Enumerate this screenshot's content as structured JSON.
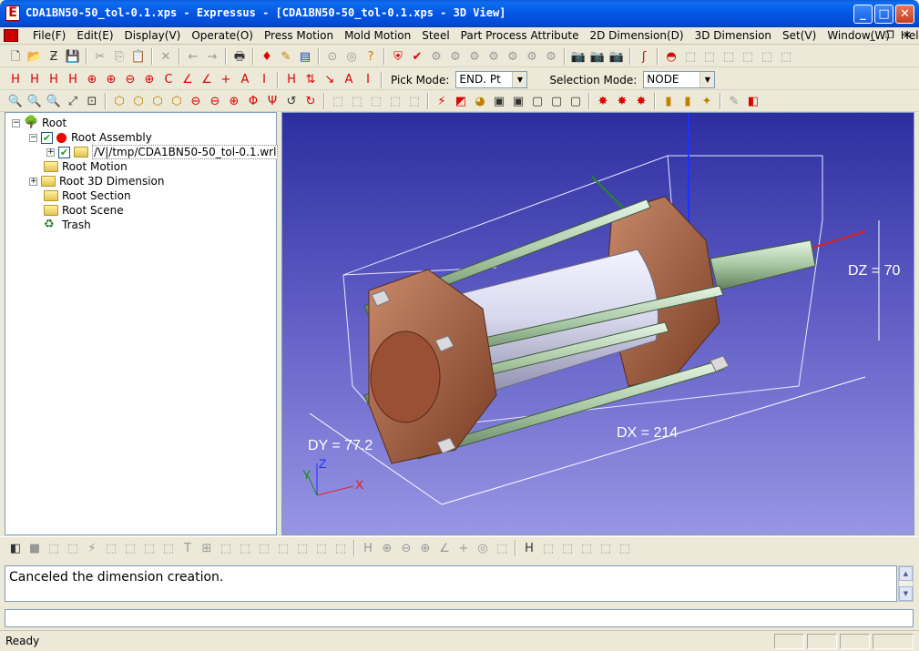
{
  "window": {
    "title": "CDA1BN50-50_tol-0.1.xps - Expressus - [CDA1BN50-50_tol-0.1.xps - 3D View]",
    "app_icon_letter": "E",
    "minimize": "_",
    "maximize": "□",
    "close": "✕"
  },
  "menu": {
    "items": [
      "File(F)",
      "Edit(E)",
      "Display(V)",
      "Operate(O)",
      "Press Motion",
      "Mold Motion",
      "Steel",
      "Part Process Attribute",
      "2D Dimension(D)",
      "3D Dimension",
      "Set(V)",
      "Window(W)",
      "Help(H)"
    ],
    "mdi_minimize": "_",
    "mdi_restore": "❐",
    "mdi_close": "✕"
  },
  "toolbar2": {
    "pick_mode_label": "Pick Mode:",
    "pick_mode_value": "END. Pt",
    "selection_mode_label": "Selection Mode:",
    "selection_mode_value": "NODE"
  },
  "tree": {
    "root": "Root",
    "root_assembly": "Root Assembly",
    "file_node": "/V|/tmp/CDA1BN50-50_tol-0.1.wrl",
    "root_motion": "Root Motion",
    "root_3d_dimension": "Root 3D Dimension",
    "root_section": "Root Section",
    "root_scene": "Root Scene",
    "trash": "Trash"
  },
  "view3d": {
    "dim_dx": "DX = 214",
    "dim_dy": "DY = 77.2",
    "dim_dz": "DZ = 70",
    "axis_x": "X",
    "axis_y": "Y",
    "axis_z": "Z"
  },
  "message": {
    "text": "Canceled the dimension creation."
  },
  "status": {
    "text": "Ready"
  }
}
